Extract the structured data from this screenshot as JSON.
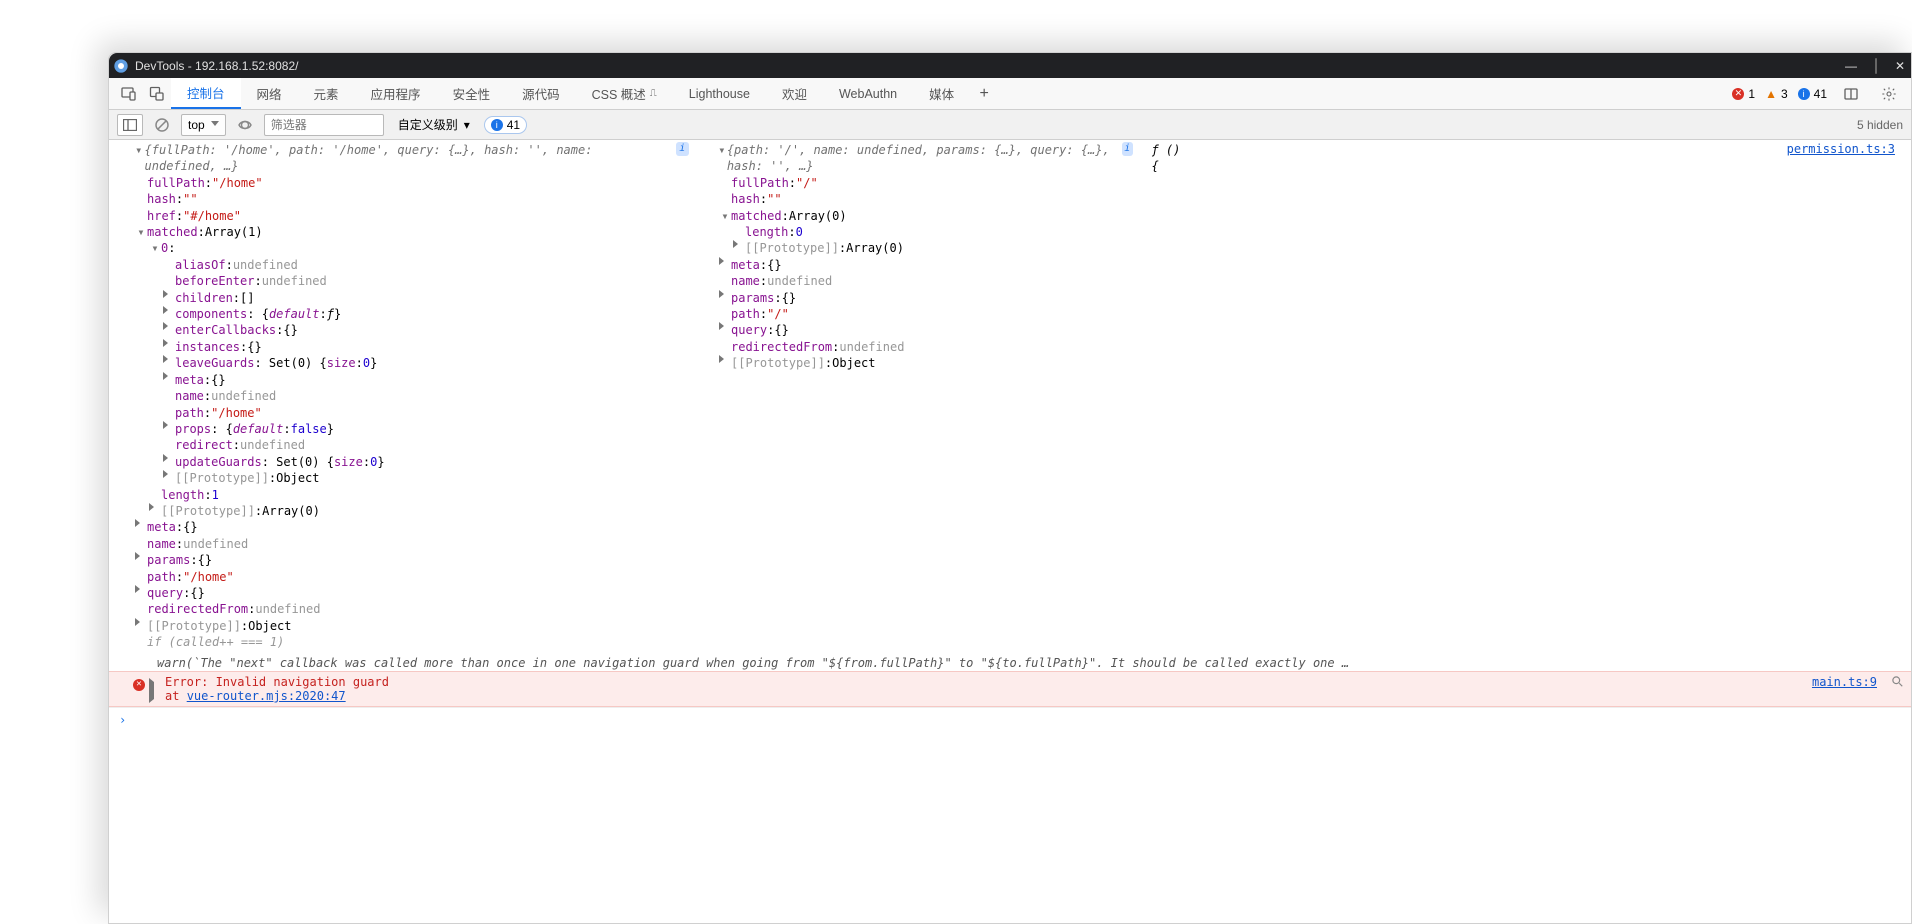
{
  "window": {
    "title": "DevTools - 192.168.1.52:8082/"
  },
  "tabs": {
    "items": [
      "控制台",
      "网络",
      "元素",
      "应用程序",
      "安全性",
      "源代码",
      "CSS 概述",
      "Lighthouse",
      "欢迎",
      "WebAuthn",
      "媒体"
    ],
    "activeIndex": 0,
    "cssBeta": "⚠"
  },
  "counters": {
    "errors": "1",
    "warnings": "3",
    "info": "41"
  },
  "toolbar": {
    "context": "top",
    "filterPlaceholder": "筛选器",
    "levelLabel": "自定义级别",
    "hidden": "5 hidden"
  },
  "log": {
    "sourceLink": "permission.ts:3",
    "leftPreview": "{fullPath: '/home', path: '/home', query: {…}, hash: '', name: undefined, …}",
    "rightPreview": "{path: '/', name: undefined, params: {…}, query: {…}, hash: '', …}",
    "fnPreview": "ƒ () {",
    "left": {
      "fullPath": "\"/home\"",
      "hash": "\"\"",
      "href": "\"#/home\"",
      "matched": "Array(1)",
      "idx0": "0",
      "aliasOf": "undefined",
      "beforeEnter": "undefined",
      "children": "[]",
      "components": "{default: ƒ}",
      "enterCallbacks": "{}",
      "instances": "{}",
      "leaveGuards": "Set(0) {size: 0}",
      "meta2": "{}",
      "name2": "undefined",
      "path2": "\"/home\"",
      "props": "{default: false}",
      "redirect": "undefined",
      "updateGuards": "Set(0) {size: 0}",
      "proto0": "Object",
      "length": "1",
      "protoArr": "Array(0)",
      "meta": "{}",
      "name": "undefined",
      "params": "{}",
      "path": "\"/home\"",
      "query": "{}",
      "redirectedFrom": "undefined",
      "proto": "Object"
    },
    "right": {
      "fullPath": "\"/\"",
      "hash": "\"\"",
      "matched": "Array(0)",
      "length": "0",
      "protoArr": "Array(0)",
      "meta": "{}",
      "name": "undefined",
      "params": "{}",
      "path": "\"/\"",
      "query": "{}",
      "redirectedFrom": "undefined",
      "proto": "Object"
    },
    "tail1": "if (called++ === 1)",
    "tail2": "warn(`The \"next\" callback was called more than once in one navigation guard when going from \"${from.fullPath}\" to \"${to.fullPath}\". It should be called exactly one …"
  },
  "error": {
    "title": "Error: Invalid navigation guard",
    "at": "    at ",
    "loc": "vue-router.mjs:2020:47",
    "src": "main.ts:9"
  }
}
